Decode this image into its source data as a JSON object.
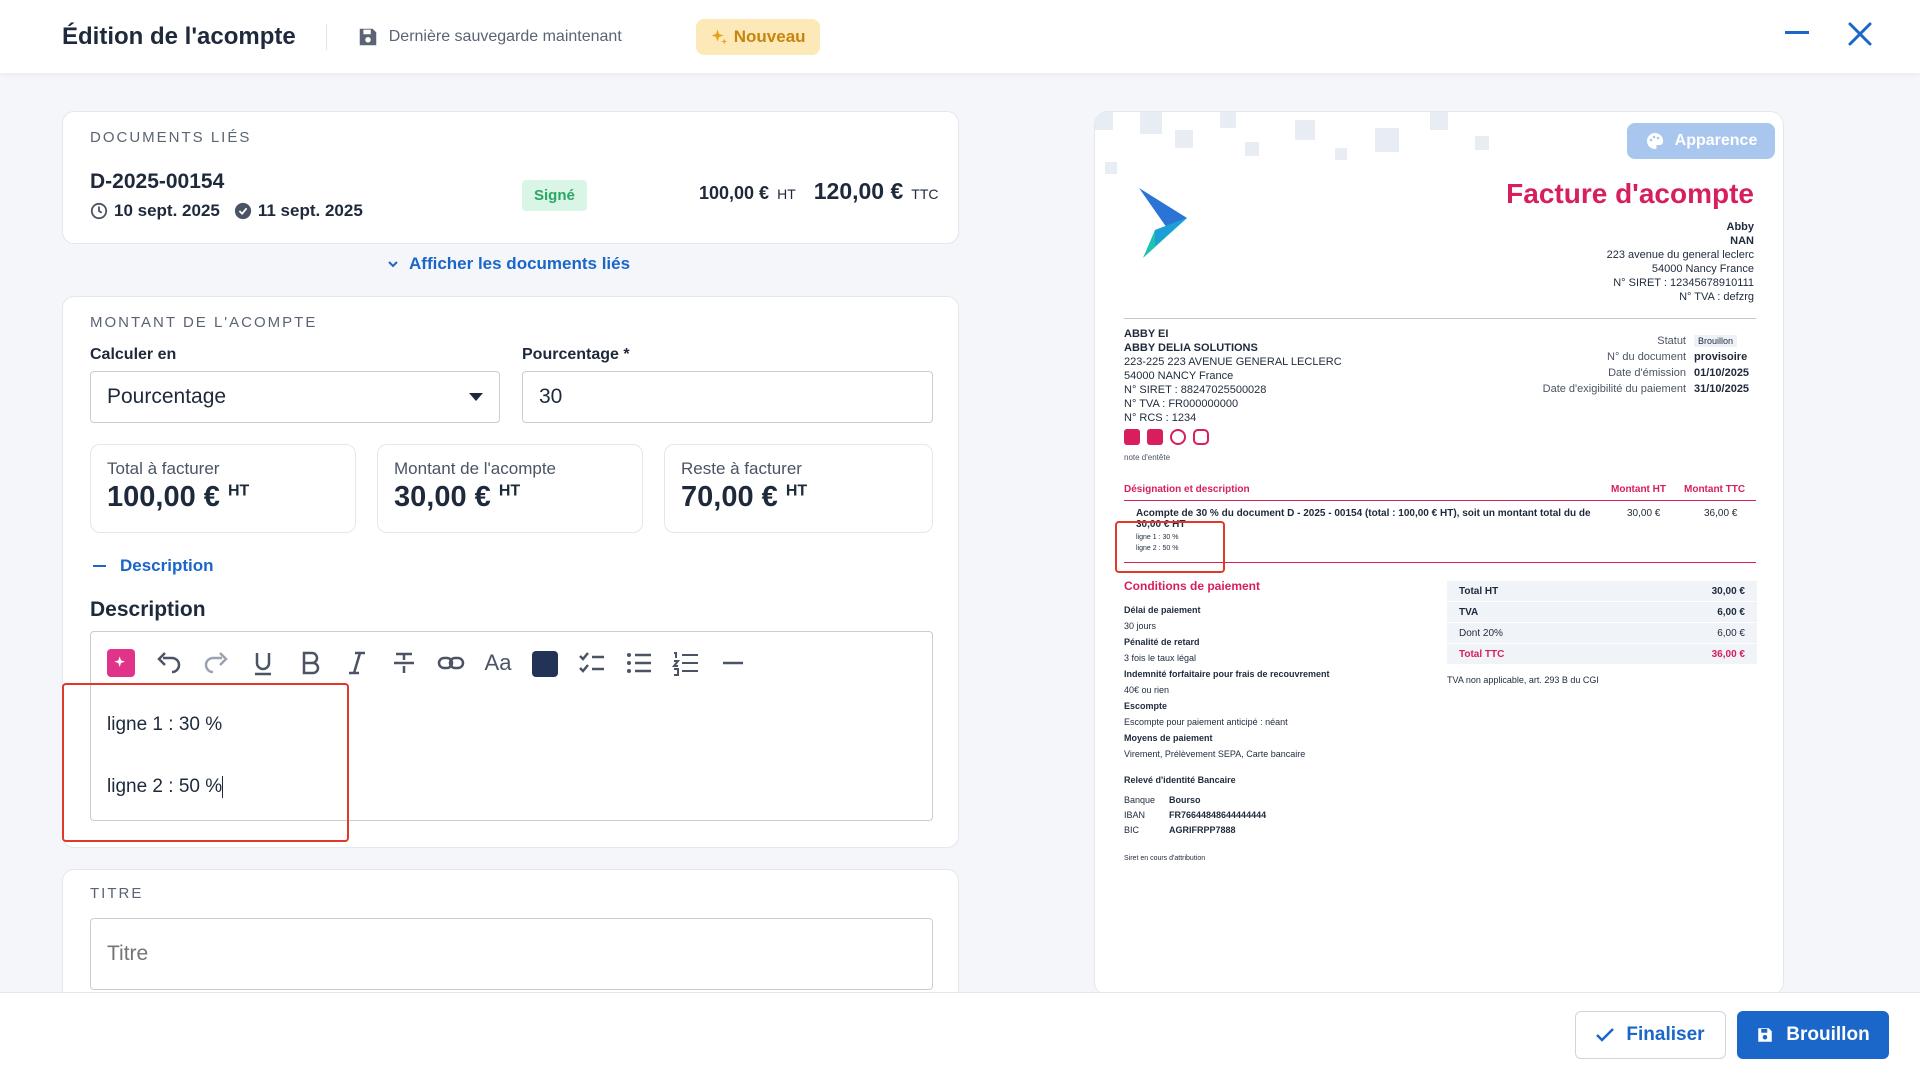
{
  "header": {
    "title": "Édition de l'acompte",
    "save_status": "Dernière sauvegarde maintenant",
    "new_badge": "Nouveau"
  },
  "linked_docs": {
    "section_title": "DOCUMENTS LIÉS",
    "doc_number": "D-2025-00154",
    "date_created": "10 sept. 2025",
    "date_signed": "11 sept. 2025",
    "status": "Signé",
    "amount_ht": "100,00 €",
    "ht": "HT",
    "amount_ttc": "120,00 €",
    "ttc": "TTC",
    "show_link": "Afficher les documents liés"
  },
  "deposit": {
    "section_title": "MONTANT DE L'ACOMPTE",
    "calc_label": "Calculer en",
    "calc_value": "Pourcentage",
    "pct_label": "Pourcentage *",
    "pct_value": "30",
    "stats": [
      {
        "label": "Total à facturer",
        "value": "100,00 €",
        "unit": "HT"
      },
      {
        "label": "Montant de l'acompte",
        "value": "30,00 €",
        "unit": "HT"
      },
      {
        "label": "Reste à facturer",
        "value": "70,00 €",
        "unit": "HT"
      }
    ],
    "desc_toggle": "Description",
    "desc_heading": "Description",
    "desc_lines": [
      "ligne 1 : 30 %",
      "ligne 2 : 50 %"
    ],
    "toolbar_text_size": "Aa"
  },
  "title_section": {
    "section_title": "TITRE",
    "placeholder": "Titre"
  },
  "footer": {
    "finalize": "Finaliser",
    "draft": "Brouillon"
  },
  "preview": {
    "appearance_button": "Apparence",
    "doc_title": "Facture d'acompte",
    "issuer": [
      "Abby",
      "NAN",
      "223 avenue du general leclerc",
      "54000 Nancy France",
      "N° SIRET : 12345678910111",
      "N° TVA : defzrg"
    ],
    "client": [
      "ABBY EI",
      "ABBY DELIA SOLUTIONS",
      "223-225 223 AVENUE GENERAL LECLERC",
      "54000 NANCY France",
      "N° SIRET : 88247025500028",
      "N° TVA : FR000000000",
      "N° RCS : 1234"
    ],
    "meta": [
      {
        "k": "Statut",
        "v": "Brouillon"
      },
      {
        "k": "N° du document",
        "v": "provisoire"
      },
      {
        "k": "Date d'émission",
        "v": "01/10/2025"
      },
      {
        "k": "Date d'exigibilité du paiement",
        "v": "31/10/2025"
      }
    ],
    "header_note": "note d'entête",
    "table_headers": [
      "Désignation et description",
      "Montant HT",
      "Montant TTC"
    ],
    "line_text": "Acompte de 30 % du document D - 2025 - 00154 (total : 100,00 € HT), soit un montant total du de 30,00 € HT",
    "line_desc": [
      "ligne 1 : 30 %",
      "ligne 2 : 50 %"
    ],
    "line_ht": "30,00 €",
    "line_ttc": "36,00 €",
    "payment_title": "Conditions de paiement",
    "payment": [
      {
        "k": "Délai de paiement",
        "v": "30 jours"
      },
      {
        "k": "Pénalité de retard",
        "v": "3 fois le taux légal"
      },
      {
        "k": "Indemnité forfaitaire pour frais de recouvrement",
        "v": "40€ ou rien"
      },
      {
        "k": "Escompte",
        "v": "Escompte pour paiement anticipé : néant"
      },
      {
        "k": "Moyens de paiement",
        "v": "Virement, Prélèvement SEPA, Carte bancaire"
      }
    ],
    "totals": [
      {
        "k": "Total HT",
        "v": "30,00 €"
      },
      {
        "k": "TVA",
        "v": "6,00 €"
      },
      {
        "k": "Dont 20%",
        "v": "6,00 €"
      },
      {
        "k": "Total TTC",
        "v": "36,00 €"
      }
    ],
    "tva_note": "TVA non applicable, art. 293 B du CGI",
    "bank_title": "Relevé d'identité Bancaire",
    "bank": [
      {
        "k": "Banque",
        "v": "Bourso"
      },
      {
        "k": "IBAN",
        "v": "FR76644848644444444"
      },
      {
        "k": "BIC",
        "v": "AGRIFRPP7888"
      }
    ],
    "siret_note": "Siret en cours d'attribution"
  },
  "colors": {
    "primary": "#1a66c9",
    "brand": "#d61f5c",
    "highlight": "#e0382b"
  }
}
